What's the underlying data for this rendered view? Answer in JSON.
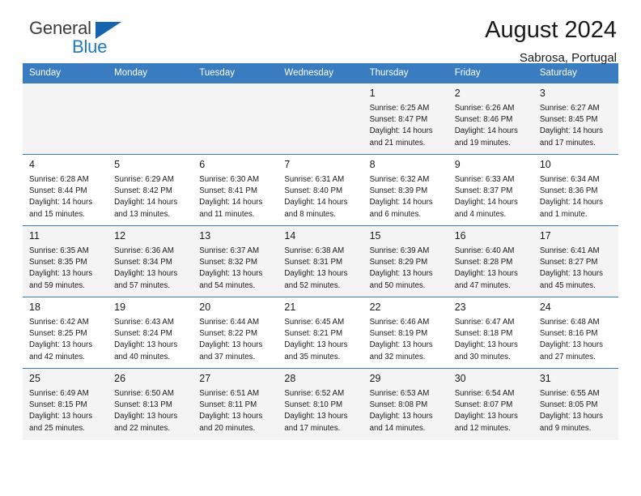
{
  "brand": {
    "name_top": "General",
    "name_bottom": "Blue",
    "triangle_color": "#1565ae",
    "blue_color": "#1f7ac4"
  },
  "header": {
    "title": "August 2024",
    "location": "Sabrosa, Portugal",
    "accent_color": "#3a7cc0"
  },
  "calendar": {
    "weekday_headers": [
      "Sunday",
      "Monday",
      "Tuesday",
      "Wednesday",
      "Thursday",
      "Friday",
      "Saturday"
    ],
    "weeks": [
      [
        {
          "day": "",
          "sunrise": "",
          "sunset": "",
          "daylight1": "",
          "daylight2": ""
        },
        {
          "day": "",
          "sunrise": "",
          "sunset": "",
          "daylight1": "",
          "daylight2": ""
        },
        {
          "day": "",
          "sunrise": "",
          "sunset": "",
          "daylight1": "",
          "daylight2": ""
        },
        {
          "day": "",
          "sunrise": "",
          "sunset": "",
          "daylight1": "",
          "daylight2": ""
        },
        {
          "day": "1",
          "sunrise": "Sunrise: 6:25 AM",
          "sunset": "Sunset: 8:47 PM",
          "daylight1": "Daylight: 14 hours",
          "daylight2": "and 21 minutes."
        },
        {
          "day": "2",
          "sunrise": "Sunrise: 6:26 AM",
          "sunset": "Sunset: 8:46 PM",
          "daylight1": "Daylight: 14 hours",
          "daylight2": "and 19 minutes."
        },
        {
          "day": "3",
          "sunrise": "Sunrise: 6:27 AM",
          "sunset": "Sunset: 8:45 PM",
          "daylight1": "Daylight: 14 hours",
          "daylight2": "and 17 minutes."
        }
      ],
      [
        {
          "day": "4",
          "sunrise": "Sunrise: 6:28 AM",
          "sunset": "Sunset: 8:44 PM",
          "daylight1": "Daylight: 14 hours",
          "daylight2": "and 15 minutes."
        },
        {
          "day": "5",
          "sunrise": "Sunrise: 6:29 AM",
          "sunset": "Sunset: 8:42 PM",
          "daylight1": "Daylight: 14 hours",
          "daylight2": "and 13 minutes."
        },
        {
          "day": "6",
          "sunrise": "Sunrise: 6:30 AM",
          "sunset": "Sunset: 8:41 PM",
          "daylight1": "Daylight: 14 hours",
          "daylight2": "and 11 minutes."
        },
        {
          "day": "7",
          "sunrise": "Sunrise: 6:31 AM",
          "sunset": "Sunset: 8:40 PM",
          "daylight1": "Daylight: 14 hours",
          "daylight2": "and 8 minutes."
        },
        {
          "day": "8",
          "sunrise": "Sunrise: 6:32 AM",
          "sunset": "Sunset: 8:39 PM",
          "daylight1": "Daylight: 14 hours",
          "daylight2": "and 6 minutes."
        },
        {
          "day": "9",
          "sunrise": "Sunrise: 6:33 AM",
          "sunset": "Sunset: 8:37 PM",
          "daylight1": "Daylight: 14 hours",
          "daylight2": "and 4 minutes."
        },
        {
          "day": "10",
          "sunrise": "Sunrise: 6:34 AM",
          "sunset": "Sunset: 8:36 PM",
          "daylight1": "Daylight: 14 hours",
          "daylight2": "and 1 minute."
        }
      ],
      [
        {
          "day": "11",
          "sunrise": "Sunrise: 6:35 AM",
          "sunset": "Sunset: 8:35 PM",
          "daylight1": "Daylight: 13 hours",
          "daylight2": "and 59 minutes."
        },
        {
          "day": "12",
          "sunrise": "Sunrise: 6:36 AM",
          "sunset": "Sunset: 8:34 PM",
          "daylight1": "Daylight: 13 hours",
          "daylight2": "and 57 minutes."
        },
        {
          "day": "13",
          "sunrise": "Sunrise: 6:37 AM",
          "sunset": "Sunset: 8:32 PM",
          "daylight1": "Daylight: 13 hours",
          "daylight2": "and 54 minutes."
        },
        {
          "day": "14",
          "sunrise": "Sunrise: 6:38 AM",
          "sunset": "Sunset: 8:31 PM",
          "daylight1": "Daylight: 13 hours",
          "daylight2": "and 52 minutes."
        },
        {
          "day": "15",
          "sunrise": "Sunrise: 6:39 AM",
          "sunset": "Sunset: 8:29 PM",
          "daylight1": "Daylight: 13 hours",
          "daylight2": "and 50 minutes."
        },
        {
          "day": "16",
          "sunrise": "Sunrise: 6:40 AM",
          "sunset": "Sunset: 8:28 PM",
          "daylight1": "Daylight: 13 hours",
          "daylight2": "and 47 minutes."
        },
        {
          "day": "17",
          "sunrise": "Sunrise: 6:41 AM",
          "sunset": "Sunset: 8:27 PM",
          "daylight1": "Daylight: 13 hours",
          "daylight2": "and 45 minutes."
        }
      ],
      [
        {
          "day": "18",
          "sunrise": "Sunrise: 6:42 AM",
          "sunset": "Sunset: 8:25 PM",
          "daylight1": "Daylight: 13 hours",
          "daylight2": "and 42 minutes."
        },
        {
          "day": "19",
          "sunrise": "Sunrise: 6:43 AM",
          "sunset": "Sunset: 8:24 PM",
          "daylight1": "Daylight: 13 hours",
          "daylight2": "and 40 minutes."
        },
        {
          "day": "20",
          "sunrise": "Sunrise: 6:44 AM",
          "sunset": "Sunset: 8:22 PM",
          "daylight1": "Daylight: 13 hours",
          "daylight2": "and 37 minutes."
        },
        {
          "day": "21",
          "sunrise": "Sunrise: 6:45 AM",
          "sunset": "Sunset: 8:21 PM",
          "daylight1": "Daylight: 13 hours",
          "daylight2": "and 35 minutes."
        },
        {
          "day": "22",
          "sunrise": "Sunrise: 6:46 AM",
          "sunset": "Sunset: 8:19 PM",
          "daylight1": "Daylight: 13 hours",
          "daylight2": "and 32 minutes."
        },
        {
          "day": "23",
          "sunrise": "Sunrise: 6:47 AM",
          "sunset": "Sunset: 8:18 PM",
          "daylight1": "Daylight: 13 hours",
          "daylight2": "and 30 minutes."
        },
        {
          "day": "24",
          "sunrise": "Sunrise: 6:48 AM",
          "sunset": "Sunset: 8:16 PM",
          "daylight1": "Daylight: 13 hours",
          "daylight2": "and 27 minutes."
        }
      ],
      [
        {
          "day": "25",
          "sunrise": "Sunrise: 6:49 AM",
          "sunset": "Sunset: 8:15 PM",
          "daylight1": "Daylight: 13 hours",
          "daylight2": "and 25 minutes."
        },
        {
          "day": "26",
          "sunrise": "Sunrise: 6:50 AM",
          "sunset": "Sunset: 8:13 PM",
          "daylight1": "Daylight: 13 hours",
          "daylight2": "and 22 minutes."
        },
        {
          "day": "27",
          "sunrise": "Sunrise: 6:51 AM",
          "sunset": "Sunset: 8:11 PM",
          "daylight1": "Daylight: 13 hours",
          "daylight2": "and 20 minutes."
        },
        {
          "day": "28",
          "sunrise": "Sunrise: 6:52 AM",
          "sunset": "Sunset: 8:10 PM",
          "daylight1": "Daylight: 13 hours",
          "daylight2": "and 17 minutes."
        },
        {
          "day": "29",
          "sunrise": "Sunrise: 6:53 AM",
          "sunset": "Sunset: 8:08 PM",
          "daylight1": "Daylight: 13 hours",
          "daylight2": "and 14 minutes."
        },
        {
          "day": "30",
          "sunrise": "Sunrise: 6:54 AM",
          "sunset": "Sunset: 8:07 PM",
          "daylight1": "Daylight: 13 hours",
          "daylight2": "and 12 minutes."
        },
        {
          "day": "31",
          "sunrise": "Sunrise: 6:55 AM",
          "sunset": "Sunset: 8:05 PM",
          "daylight1": "Daylight: 13 hours",
          "daylight2": "and 9 minutes."
        }
      ]
    ]
  }
}
